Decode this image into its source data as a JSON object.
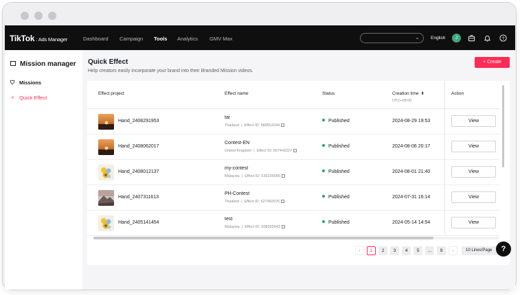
{
  "window": {
    "controls": [
      "close",
      "minimize",
      "maximize"
    ]
  },
  "topnav": {
    "logo": "TikTok",
    "logo_sub": ": Ads Manager",
    "items": [
      {
        "label": "Dashboard",
        "active": false
      },
      {
        "label": "Campaign",
        "active": false
      },
      {
        "label": "Tools",
        "active": true
      },
      {
        "label": "Analytics",
        "active": false
      },
      {
        "label": "GMV Max",
        "active": false
      }
    ],
    "search_placeholder": "",
    "language": "English",
    "avatar_initial": "J",
    "icons": [
      "briefcase-icon",
      "bell-icon",
      "help-circle-icon"
    ]
  },
  "sidebar": {
    "title": "Mission manager",
    "items": [
      {
        "label": "Missions",
        "icon": "shield-icon",
        "active": false
      },
      {
        "label": "Quick Effect",
        "icon": "effect-icon",
        "active": true
      }
    ]
  },
  "page": {
    "title": "Quick Effect",
    "subtitle": "Help creators easily incorporate your brand into their Branded Mission videos.",
    "create_button": "+ Create"
  },
  "table": {
    "columns": {
      "project": "Effect project",
      "name": "Effect name",
      "status": "Status",
      "ctime": "Creation time",
      "ctime_sub": "UTC+08:00",
      "action": "Action"
    },
    "rows": [
      {
        "project": "Hand_2408291953",
        "thumb": "sunset",
        "name": "tai",
        "country": "Thailand",
        "effect_id": "Effect ID: 689553344",
        "status": "Published",
        "ctime": "2024-08-29 19:53",
        "action": "View"
      },
      {
        "project": "Hand_2408062017",
        "thumb": "sunset",
        "name": "Contest-EN",
        "country": "United Kingdom",
        "effect_id": "Effect ID: 567443227",
        "status": "Published",
        "ctime": "2024-08-06 20:17",
        "action": "View"
      },
      {
        "project": "Hand_2408012137",
        "thumb": "flower",
        "name": "my-contest",
        "country": "Malaysia",
        "effect_id": "Effect ID: 535235685",
        "status": "Published",
        "ctime": "2024-08-01 21:40",
        "action": "View"
      },
      {
        "project": "Hand_2407311613",
        "thumb": "mountain",
        "name": "PH-Contest",
        "country": "Thailand",
        "effect_id": "Effect ID: 527482976",
        "status": "Published",
        "ctime": "2024-07-31 16:14",
        "action": "View"
      },
      {
        "project": "Hand_2405141454",
        "thumb": "flower",
        "name": "test",
        "country": "Malaysia",
        "effect_id": "Effect ID: 508335943",
        "status": "Published",
        "ctime": "2024-05-14 14:54",
        "action": "View"
      }
    ]
  },
  "pagination": {
    "prev": "‹",
    "pages": [
      "1",
      "2",
      "3",
      "4",
      "5",
      "...",
      "9"
    ],
    "current": "1",
    "next": "›",
    "page_size": "10 Lines/Page"
  },
  "help_button": "?",
  "colors": {
    "accent": "#fe2c55",
    "status_published": "#1dab5f",
    "nav_bg": "#0f0f10"
  }
}
